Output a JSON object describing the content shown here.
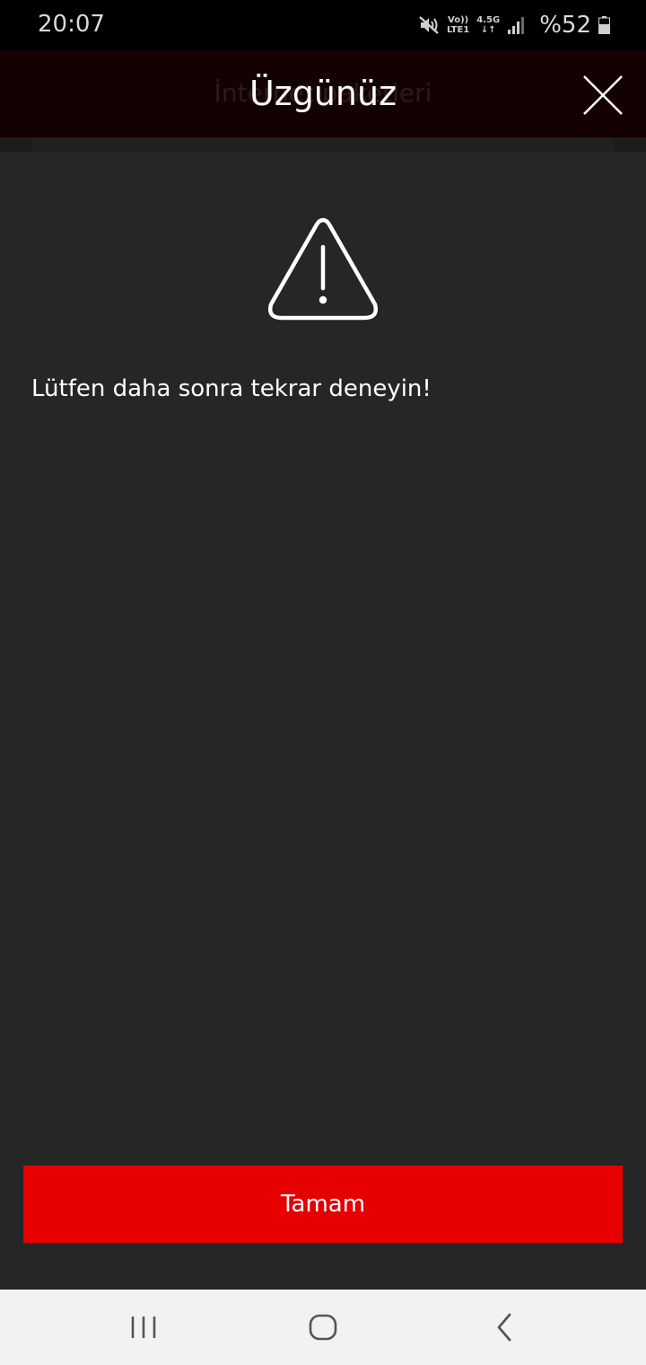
{
  "status_bar": {
    "time": "20:07",
    "volte_top": "Vo))",
    "volte_bottom": "LTE1",
    "network_type": "4.5G",
    "battery": "%52",
    "icons": [
      "mute-icon",
      "signal-icon",
      "battery-icon"
    ]
  },
  "header": {
    "background_title": "İnternet paketleri",
    "title": "Üzgünüz",
    "close_icon": "close-icon"
  },
  "dialog": {
    "icon": "warning-icon",
    "message": "Lütfen daha sonra tekrar deneyin!",
    "ok_label": "Tamam"
  },
  "nav_bar": {
    "icons": [
      "recent-apps-icon",
      "home-icon",
      "back-icon"
    ]
  },
  "colors": {
    "accent": "#e60000",
    "dialog_bg": "#262626",
    "header_bg": "#140202",
    "status_bg": "#000000",
    "nav_bg": "#f2f2f2"
  }
}
